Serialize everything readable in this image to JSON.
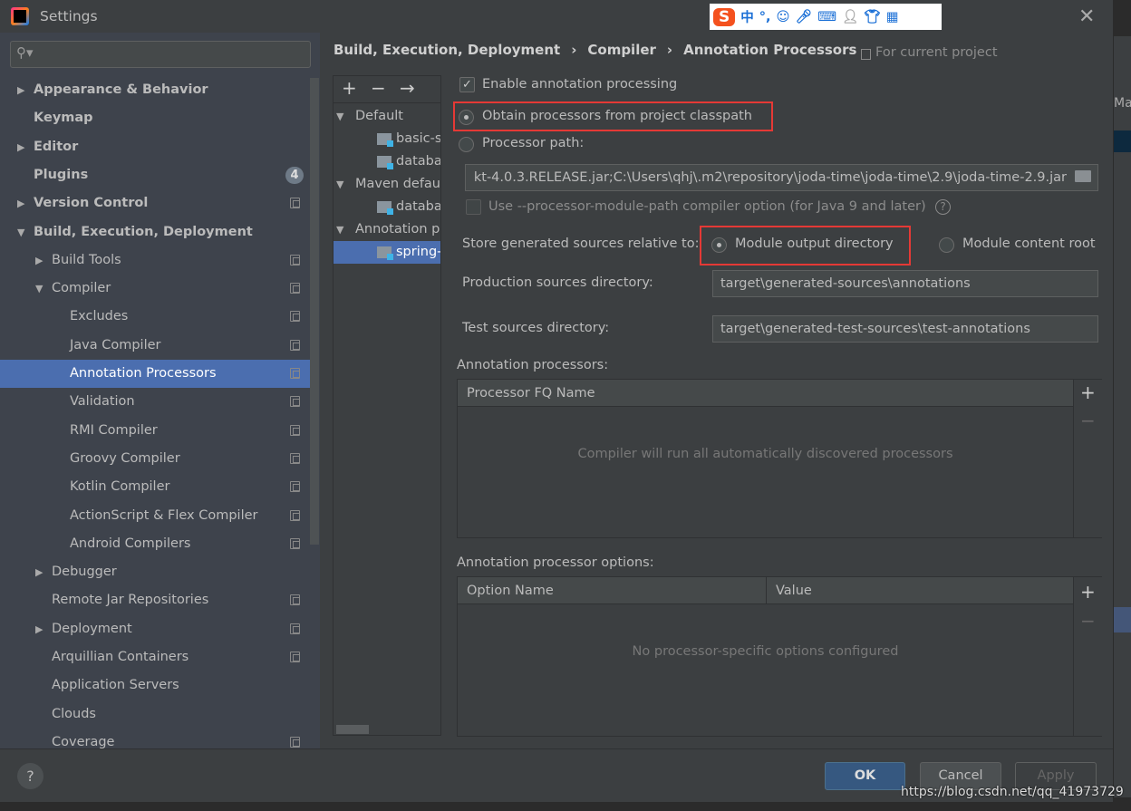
{
  "window": {
    "title": "Settings",
    "close_icon": "close-icon"
  },
  "ime_toolbar": {
    "items": [
      "S",
      "中",
      "°,",
      "☺",
      "mic",
      "keyboard",
      "user",
      "shirt",
      "grid"
    ]
  },
  "sidebar": {
    "search_placeholder": "",
    "items": [
      {
        "label": "Appearance & Behavior",
        "level": 0,
        "expand": "collapsed",
        "bold": true
      },
      {
        "label": "Keymap",
        "level": 0,
        "bold": true
      },
      {
        "label": "Editor",
        "level": 0,
        "expand": "collapsed",
        "bold": true
      },
      {
        "label": "Plugins",
        "level": 0,
        "bold": true,
        "badge": "4"
      },
      {
        "label": "Version Control",
        "level": 0,
        "expand": "collapsed",
        "bold": true,
        "project": true
      },
      {
        "label": "Build, Execution, Deployment",
        "level": 0,
        "expand": "expanded",
        "bold": true
      },
      {
        "label": "Build Tools",
        "level": 1,
        "expand": "collapsed",
        "project": true
      },
      {
        "label": "Compiler",
        "level": 1,
        "expand": "expanded",
        "project": true
      },
      {
        "label": "Excludes",
        "level": 2,
        "project": true
      },
      {
        "label": "Java Compiler",
        "level": 2,
        "project": true
      },
      {
        "label": "Annotation Processors",
        "level": 2,
        "project": true,
        "selected": true
      },
      {
        "label": "Validation",
        "level": 2,
        "project": true
      },
      {
        "label": "RMI Compiler",
        "level": 2,
        "project": true
      },
      {
        "label": "Groovy Compiler",
        "level": 2,
        "project": true
      },
      {
        "label": "Kotlin Compiler",
        "level": 2,
        "project": true
      },
      {
        "label": "ActionScript & Flex Compiler",
        "level": 2,
        "project": true
      },
      {
        "label": "Android Compilers",
        "level": 2,
        "project": true
      },
      {
        "label": "Debugger",
        "level": 1,
        "expand": "collapsed"
      },
      {
        "label": "Remote Jar Repositories",
        "level": 1,
        "project": true
      },
      {
        "label": "Deployment",
        "level": 1,
        "expand": "collapsed",
        "project": true
      },
      {
        "label": "Arquillian Containers",
        "level": 1,
        "project": true
      },
      {
        "label": "Application Servers",
        "level": 1
      },
      {
        "label": "Clouds",
        "level": 1
      },
      {
        "label": "Coverage",
        "level": 1,
        "project": true
      }
    ]
  },
  "breadcrumb": [
    "Build, Execution, Deployment",
    "Compiler",
    "Annotation Processors"
  ],
  "for_current_project": "For current project",
  "profiles": {
    "toolbar": [
      "+",
      "−",
      "→"
    ],
    "items": [
      {
        "label": "Default",
        "type": "group"
      },
      {
        "label": "basic-s",
        "type": "module"
      },
      {
        "label": "databa",
        "type": "module"
      },
      {
        "label": "Maven defau",
        "type": "group"
      },
      {
        "label": "databa",
        "type": "module"
      },
      {
        "label": "Annotation p",
        "type": "group"
      },
      {
        "label": "spring-",
        "type": "module",
        "selected": true
      }
    ]
  },
  "settings": {
    "enable_label": "Enable annotation processing",
    "enable_checked": true,
    "obtain_label": "Obtain processors from project classpath",
    "obtain_selected": true,
    "processor_path_label": "Processor path:",
    "processor_path_value": "kt-4.0.3.RELEASE.jar;C:\\Users\\qhj\\.m2\\repository\\joda-time\\joda-time\\2.9\\joda-time-2.9.jar",
    "module_path_label": "Use --processor-module-path compiler option (for Java 9 and later)",
    "store_label": "Store generated sources relative to:",
    "store_option1": "Module output directory",
    "store_option2": "Module content root",
    "prod_label": "Production sources directory:",
    "prod_value": "target\\generated-sources\\annotations",
    "test_label": "Test sources directory:",
    "test_value": "target\\generated-test-sources\\test-annotations"
  },
  "processors": {
    "label": "Annotation processors:",
    "column": "Processor FQ Name",
    "empty": "Compiler will run all automatically discovered processors",
    "add": "+",
    "remove": "−"
  },
  "options": {
    "label": "Annotation processor options:",
    "columns": [
      "Option Name",
      "Value"
    ],
    "empty": "No processor-specific options configured",
    "add": "+",
    "remove": "−"
  },
  "buttons": {
    "help": "?",
    "ok": "OK",
    "cancel": "Cancel",
    "apply": "Apply"
  },
  "watermark": "https://blog.csdn.net/qq_41973729",
  "colors": {
    "selection": "#4b6eaf",
    "highlight_box": "#e53935",
    "ok_button": "#365880"
  }
}
